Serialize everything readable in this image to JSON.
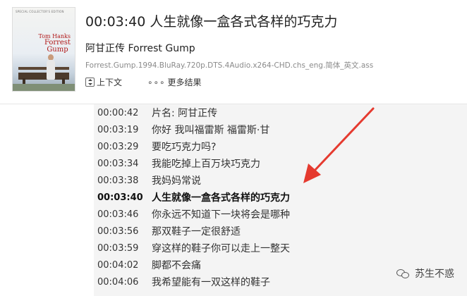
{
  "header": {
    "title": "00:03:40 人生就像一盒各式各样的巧克力",
    "movie_name": "阿甘正传 Forrest Gump",
    "file_name": "Forrest.Gump.1994.BluRay.720p.DTS.4Audio.x264-CHD.chs_eng.简体_英文.ass",
    "context_label": "上下文",
    "more_label": "更多结果",
    "poster": {
      "top_text": "SPECIAL COLLECTOR'S EDITION",
      "actor": "Tom Hanks",
      "title_line1": "Forrest",
      "title_line2": "Gump"
    }
  },
  "subtitles": [
    {
      "time": "00:00:42",
      "text": "片名: 阿甘正传"
    },
    {
      "time": "00:03:19",
      "text": "你好 我叫福雷斯 福雷斯·甘"
    },
    {
      "time": "00:03:29",
      "text": "要吃巧克力吗?"
    },
    {
      "time": "00:03:34",
      "text": "我能吃掉上百万块巧克力"
    },
    {
      "time": "00:03:38",
      "text": "我妈妈常说"
    },
    {
      "time": "00:03:40",
      "text": "人生就像一盒各式各样的巧克力"
    },
    {
      "time": "00:03:46",
      "text": "你永远不知道下一块将会是哪种"
    },
    {
      "time": "00:03:56",
      "text": "那双鞋子一定很舒适"
    },
    {
      "time": "00:03:59",
      "text": "穿这样的鞋子你可以走上一整天"
    },
    {
      "time": "00:04:02",
      "text": "脚都不会痛"
    },
    {
      "time": "00:04:06",
      "text": "我希望能有一双这样的鞋子"
    }
  ],
  "current_index": 5,
  "watermark": {
    "text": "苏生不惑",
    "icon": "wechat-icon"
  },
  "colors": {
    "arrow": "#e53a2f",
    "panel_bg": "#f4f4f4"
  }
}
